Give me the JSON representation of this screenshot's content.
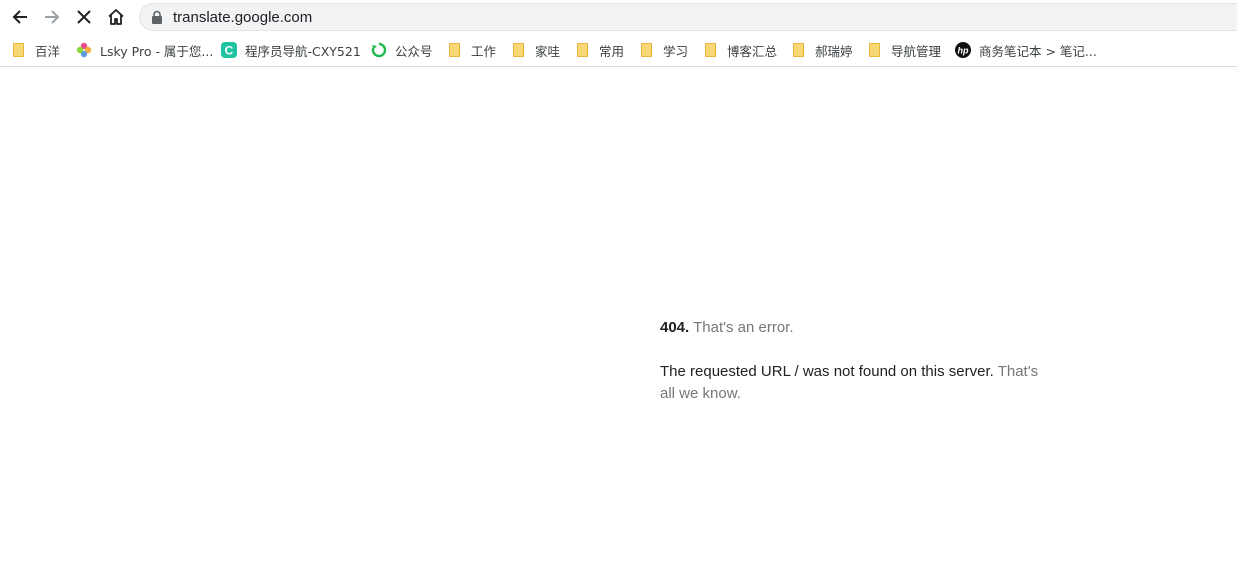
{
  "browser": {
    "url": "translate.google.com"
  },
  "bookmarks": [
    {
      "label": "百洋",
      "icon": "folder-icon"
    },
    {
      "label": "Lsky Pro - 属于您...",
      "icon": "pinwheel-icon"
    },
    {
      "label": "程序员导航-CXY521",
      "icon": "c-logo-icon"
    },
    {
      "label": "公众号",
      "icon": "recycle-icon"
    },
    {
      "label": "工作",
      "icon": "folder-icon"
    },
    {
      "label": "家哇",
      "icon": "folder-icon"
    },
    {
      "label": "常用",
      "icon": "folder-icon"
    },
    {
      "label": "学习",
      "icon": "folder-icon"
    },
    {
      "label": "博客汇总",
      "icon": "folder-icon"
    },
    {
      "label": "郝瑞婷",
      "icon": "folder-icon"
    },
    {
      "label": "导航管理",
      "icon": "folder-icon"
    },
    {
      "label": "商务笔记本 > 笔记...",
      "icon": "hp-logo-icon"
    }
  ],
  "error": {
    "code": "404.",
    "title": "That's an error.",
    "message": "The requested URL / was not found on this server.",
    "note": "That's all we know."
  }
}
